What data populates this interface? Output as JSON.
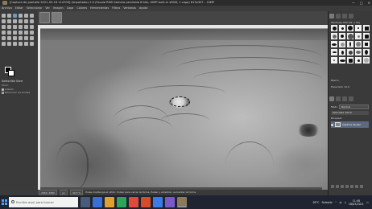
{
  "window": {
    "title": "[Captura de pantalla 2021-03-18 114709] (importado)-1.0 (Escala RGB Gamma percibida 8 bits, GIMP built-in sRGB, 1 capa) 613x357 – GIMP",
    "controls": [
      "—",
      "□",
      "✕"
    ]
  },
  "menubar": [
    "Archivo",
    "Editar",
    "Seleccionar",
    "Ver",
    "Imagen",
    "Capa",
    "Colores",
    "Herramientas",
    "Filtros",
    "Ventanas",
    "Ayuda"
  ],
  "toolbox": {
    "options_title": "Selección libre",
    "mode_label": "Modo:",
    "antialias": "Alisado",
    "feather": "Difuminar los bordes"
  },
  "canvas": {
    "description_free_select_active": true
  },
  "statusbar": {
    "coords": "2960, 4860",
    "unit": "px",
    "zoom": "49,5 %",
    "message": "Pulse mantenga el ratón: Pulsar para cerrar la forma. Pulsar y arrastrar, aumentar la forma"
  },
  "right_panel": {
    "brush_title": "Hardness 050 (51 × 51)",
    "tags_label": "Básico,",
    "spacing_label": "Espaciado",
    "spacing_value": "10,0",
    "mode_label": "Modo",
    "mode_value": "Normal",
    "opacity_label": "Opacidad",
    "opacity_value": "100,0",
    "lock_label": "Bloquear:",
    "layer_name": "Captura de pan"
  },
  "taskbar": {
    "search_placeholder": "Escribe aquí para buscar",
    "weather": "28°C",
    "weather_text": "Soleado",
    "time": "11:48",
    "date": "18/03/2021",
    "app_colors": [
      "#3a6fd8",
      "#e0a030",
      "#2aa55a",
      "#e04a3a",
      "#3b7be8",
      "#d94a2a",
      "#7a5ac8",
      "#ffffff",
      "#5a8a3a"
    ]
  }
}
